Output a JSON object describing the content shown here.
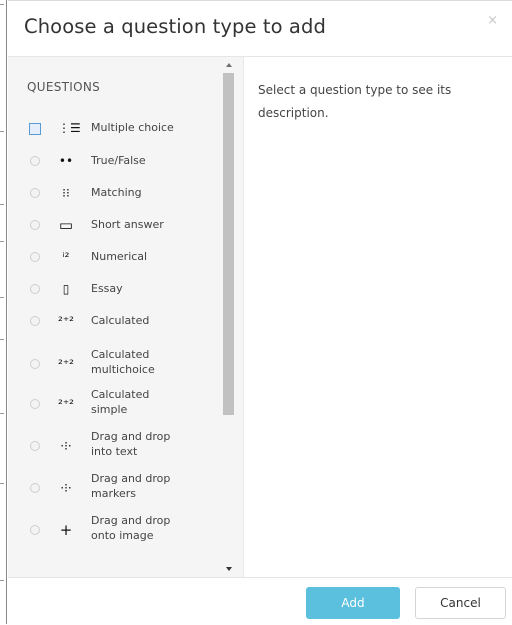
{
  "dialog": {
    "title": "Choose a question type to add",
    "close_label": "×"
  },
  "questions": {
    "section_title": "QUESTIONS",
    "items": [
      {
        "line1": "Multiple choice",
        "line2": "",
        "icon": "multiple-choice-icon",
        "selected": true
      },
      {
        "line1": "True/False",
        "line2": "",
        "icon": "true-false-icon",
        "selected": false
      },
      {
        "line1": "Matching",
        "line2": "",
        "icon": "matching-icon",
        "selected": false
      },
      {
        "line1": "Short answer",
        "line2": "",
        "icon": "short-answer-icon",
        "selected": false
      },
      {
        "line1": "Numerical",
        "line2": "",
        "icon": "numerical-icon",
        "selected": false
      },
      {
        "line1": "Essay",
        "line2": "",
        "icon": "essay-icon",
        "selected": false
      },
      {
        "line1": "Calculated",
        "line2": "",
        "icon": "calculated-icon",
        "selected": false
      },
      {
        "line1": "Calculated",
        "line2": "multichoice",
        "icon": "calculated-multichoice-icon",
        "selected": false
      },
      {
        "line1": "Calculated",
        "line2": "simple",
        "icon": "calculated-simple-icon",
        "selected": false
      },
      {
        "line1": "Drag and drop",
        "line2": "into text",
        "icon": "drag-drop-text-icon",
        "selected": false
      },
      {
        "line1": "Drag and drop",
        "line2": "markers",
        "icon": "drag-drop-markers-icon",
        "selected": false
      },
      {
        "line1": "Drag and drop",
        "line2": "onto image",
        "icon": "drag-drop-image-icon",
        "selected": false
      }
    ]
  },
  "description": {
    "text": "Select a question type to see its description."
  },
  "footer": {
    "add_label": "Add",
    "cancel_label": "Cancel"
  },
  "colors": {
    "add_button": "#5bc0de",
    "selected_radio_border": "#5b9bd5"
  }
}
